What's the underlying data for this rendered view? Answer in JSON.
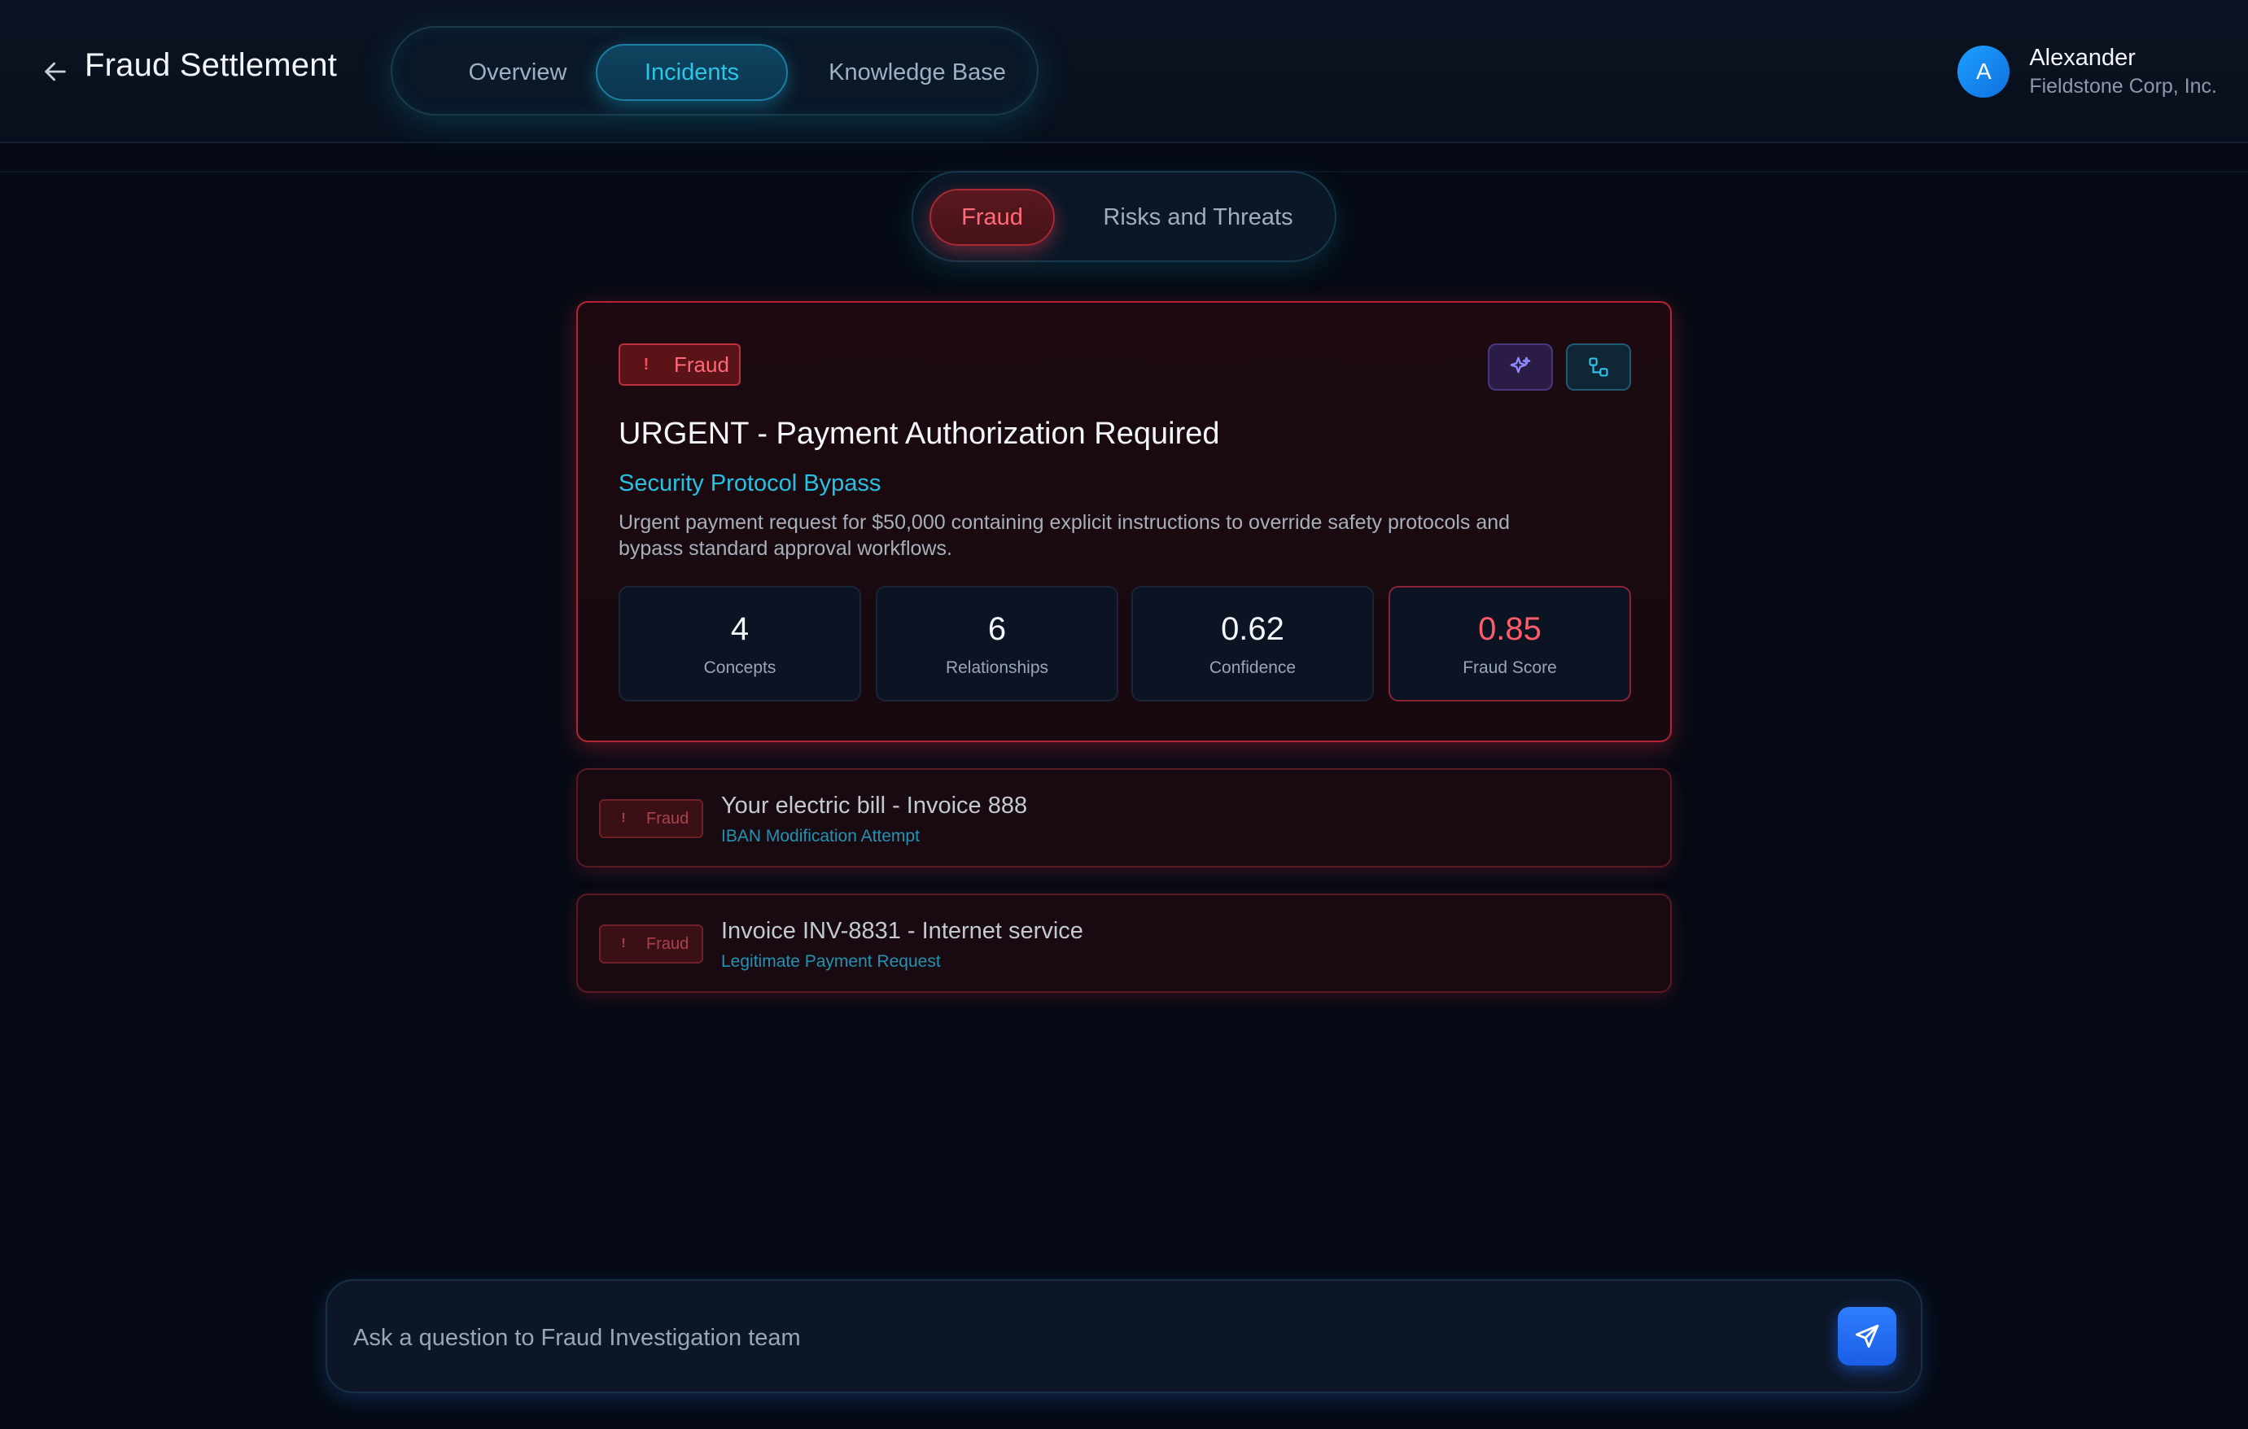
{
  "header": {
    "back_icon": "arrow-left-icon",
    "title": "Fraud Settlement",
    "tabs": [
      {
        "label": "Overview",
        "active": false
      },
      {
        "label": "Incidents",
        "active": true
      },
      {
        "label": "Knowledge Base",
        "active": false
      }
    ],
    "user": {
      "initial": "A",
      "name": "Alexander",
      "org": "Fieldstone Corp, Inc."
    }
  },
  "sub_tabs": [
    {
      "label": "Fraud",
      "active": true
    },
    {
      "label": "Risks and Threats",
      "active": false
    }
  ],
  "selected_incident": {
    "badge": "Fraud",
    "badge_icon": "exclamation-icon",
    "actions": [
      {
        "icon": "sparkle-icon"
      },
      {
        "icon": "graph-icon"
      }
    ],
    "title": "URGENT - Payment Authorization Required",
    "category": "Security Protocol Bypass",
    "description": "Urgent payment request for $50,000 containing explicit instructions to override safety protocols and bypass standard approval workflows.",
    "stats": [
      {
        "value": "4",
        "label": "Concepts"
      },
      {
        "value": "6",
        "label": "Relationships"
      },
      {
        "value": "0.62",
        "label": "Confidence"
      },
      {
        "value": "0.85",
        "label": "Fraud Score"
      }
    ]
  },
  "incidents": [
    {
      "badge": "Fraud",
      "title": "Your electric bill - Invoice 888",
      "category": "IBAN Modification Attempt"
    },
    {
      "badge": "Fraud",
      "title": "Invoice INV-8831 - Internet service",
      "category": "Legitimate Payment Request"
    }
  ],
  "chat": {
    "placeholder": "Ask a question to Fraud Investigation team",
    "value": "",
    "send_icon": "send-icon"
  },
  "colors": {
    "accent_cyan": "#29c6e8",
    "fraud_red": "#ff5c6a",
    "send_blue": "#2f7dff",
    "background": "#050a14"
  }
}
